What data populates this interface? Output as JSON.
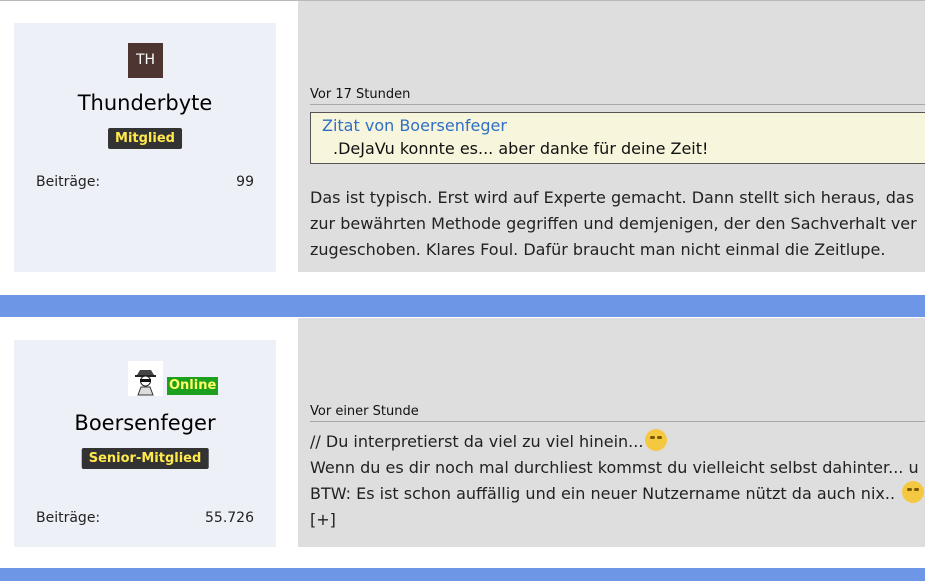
{
  "posts": [
    {
      "author": {
        "avatar_initials": "TH",
        "name": "Thunderbyte",
        "rank": "Mitglied",
        "posts_label": "Beiträge:",
        "posts_count": "99"
      },
      "timestamp": "Vor 17 Stunden",
      "quote": {
        "author_line": "Zitat von Boersenfeger",
        "text": ".DeJaVu konnte es... aber danke für deine Zeit!"
      },
      "body": [
        "Das ist typisch. Erst wird auf Experte gemacht. Dann stellt sich heraus, das",
        "zur bewährten Methode gegriffen und demjenigen, der den Sachverhalt ver",
        "zugeschoben. Klares Foul. Dafür braucht man nicht einmal die Zeitlupe."
      ]
    },
    {
      "author": {
        "avatar_icon": "detective-avatar-icon",
        "online_label": "Online",
        "name": "Boersenfeger",
        "rank": "Senior-Mitglied",
        "posts_label": "Beiträge:",
        "posts_count": "55.726"
      },
      "timestamp": "Vor einer Stunde",
      "body": [
        "// Du interpretierst da viel zu viel hinein...",
        "Wenn du es dir noch mal durchliest kommst du vielleicht selbst dahinter... u",
        "BTW: Es ist schon auffällig und ein neuer Nutzername nützt da auch nix.."
      ],
      "expand_label": "[+]"
    }
  ],
  "colors": {
    "separator": "#6e96e7",
    "card_bg": "#eef0f7",
    "content_bg": "#dedede",
    "rank_badge_bg": "#333333",
    "rank_badge_text": "#ffe94d",
    "online_bg": "#1da01d",
    "quote_author": "#2f6fc4"
  }
}
